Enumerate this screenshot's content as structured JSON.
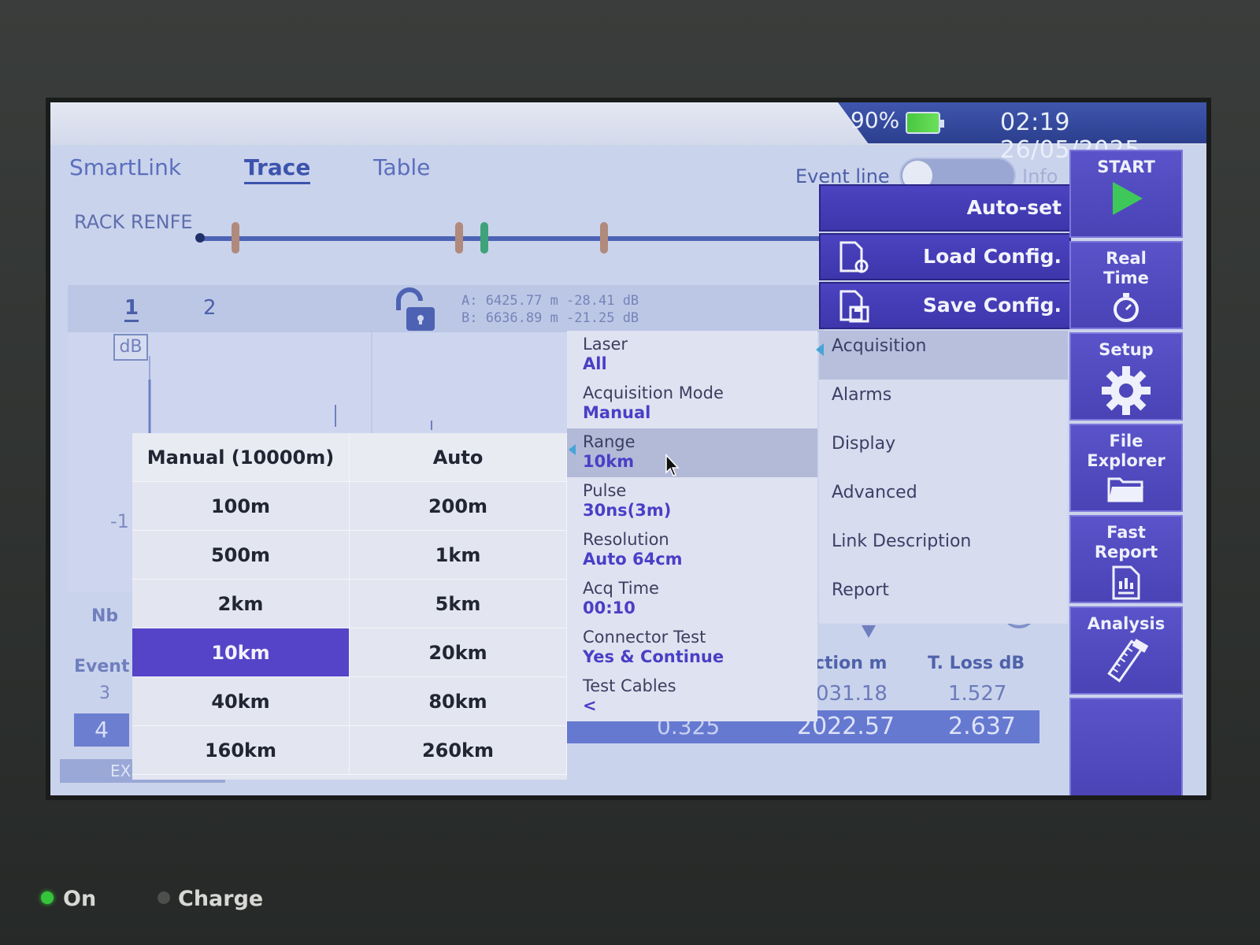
{
  "status": {
    "battery": "90%",
    "time": "02:19",
    "date": "26/05/2025"
  },
  "tabs": [
    {
      "label": "SmartLink"
    },
    {
      "label": "Trace"
    },
    {
      "label": "Table"
    }
  ],
  "event_line": {
    "label": "Event line",
    "info_label": "Info"
  },
  "link": {
    "name": "RACK RENFE"
  },
  "trace": {
    "tabs": [
      {
        "label": "1"
      },
      {
        "label": "2"
      }
    ],
    "marker_a": "A: 6425.77 m -28.41 dB",
    "marker_b": "B: 6636.89 m -21.25 dB",
    "unit": "dB",
    "axis_fragment": "-1"
  },
  "table": {
    "nb_label": "Nb",
    "event_label": "Event",
    "row3_id": "3",
    "row4_id": "4",
    "location_header": "ction m",
    "loss_header": "T. Loss dB",
    "row3_location": "031.18",
    "row3_loss": "1.527",
    "row4_a": "0.325",
    "row4_location": "2022.57",
    "row4_loss": "2.637",
    "export_label": "EX"
  },
  "sidebar": {
    "start": "START",
    "real_time_1": "Real",
    "real_time_2": "Time",
    "setup": "Setup",
    "file_explorer_1": "File",
    "file_explorer_2": "Explorer",
    "fast_report_1": "Fast",
    "fast_report_2": "Report",
    "analysis": "Analysis"
  },
  "config": {
    "auto_set": "Auto-set",
    "load_config": "Load Config.",
    "save_config": "Save Config."
  },
  "setup_menu": [
    {
      "label": "Acquisition"
    },
    {
      "label": "Alarms"
    },
    {
      "label": "Display"
    },
    {
      "label": "Advanced"
    },
    {
      "label": "Link Description"
    },
    {
      "label": "Report"
    }
  ],
  "params": [
    {
      "label": "Laser",
      "value": "All"
    },
    {
      "label": "Acquisition Mode",
      "value": "Manual"
    },
    {
      "label": "Range",
      "value": "10km"
    },
    {
      "label": "Pulse",
      "value": "30ns(3m)"
    },
    {
      "label": "Resolution",
      "value": "Auto 64cm"
    },
    {
      "label": "Acq Time",
      "value": "00:10"
    },
    {
      "label": "Connector Test",
      "value": "Yes & Continue"
    },
    {
      "label": "Test Cables",
      "value": "<"
    }
  ],
  "range_options": [
    {
      "label": "Manual (10000m)"
    },
    {
      "label": "Auto"
    },
    {
      "label": "100m"
    },
    {
      "label": "200m"
    },
    {
      "label": "500m"
    },
    {
      "label": "1km"
    },
    {
      "label": "2km"
    },
    {
      "label": "5km"
    },
    {
      "label": "10km"
    },
    {
      "label": "20km"
    },
    {
      "label": "40km"
    },
    {
      "label": "80km"
    },
    {
      "label": "160km"
    },
    {
      "label": "260km"
    }
  ],
  "range_selected": "10km",
  "device": {
    "led_on": "On",
    "led_charge": "Charge"
  },
  "colors": {
    "accent": "#5543c8",
    "sidebar": "#4a43b6",
    "screen_bg": "#cad3ec",
    "led_on": "#36c43a"
  }
}
